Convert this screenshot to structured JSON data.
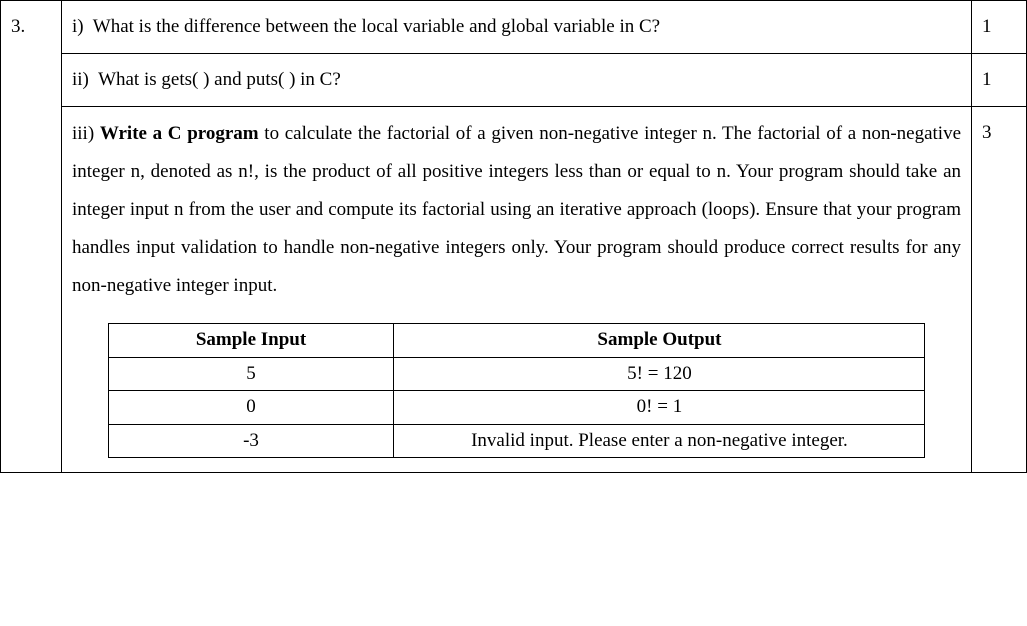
{
  "question_number": "3.",
  "parts": {
    "i": {
      "label": "i)",
      "text": "What is the difference between the local variable and global variable in C?",
      "marks": "1"
    },
    "ii": {
      "label": "ii)",
      "text": "What is gets( ) and puts( ) in C?",
      "marks": "1"
    },
    "iii": {
      "label": "iii)",
      "bold_lead": "Write a C program",
      "rest": " to calculate the factorial of a given non-negative integer n. The factorial of a non-negative integer n, denoted as n!, is the product of all positive integers less than or equal to n. Your program should take an integer input n from the user and compute its factorial using an iterative approach (loops). Ensure that your program handles input validation to handle non-negative integers only. Your program should produce correct results for any non-negative integer input.",
      "marks": "3"
    }
  },
  "sample_table": {
    "headers": {
      "input": "Sample Input",
      "output": "Sample Output"
    },
    "rows": [
      {
        "input": "5",
        "output": "5! = 120"
      },
      {
        "input": "0",
        "output": "0! = 1"
      },
      {
        "input": "-3",
        "output": "Invalid input. Please enter a non-negative integer."
      }
    ]
  }
}
